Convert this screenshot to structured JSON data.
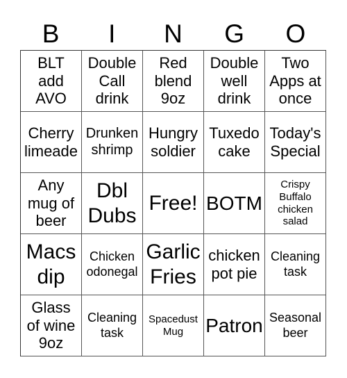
{
  "header": {
    "letters": [
      "B",
      "I",
      "N",
      "G",
      "O"
    ]
  },
  "grid": {
    "rows": [
      [
        "BLT\nadd\nAVO",
        "Double\nCall\ndrink",
        "Red\nblend\n9oz",
        "Double\nwell\ndrink",
        "Two\nApps at\nonce"
      ],
      [
        "Cherry\nlimeade",
        "Drunken\nshrimp",
        "Hungry\nsoldier",
        "Tuxedo\ncake",
        "Today's\nSpecial"
      ],
      [
        "Any\nmug of\nbeer",
        "Dbl\nDubs",
        "Free!",
        "BOTM",
        "Crispy\nBuffalo\nchicken\nsalad"
      ],
      [
        "Macs\ndip",
        "Chicken\nodonegal",
        "Garlic\nFries",
        "chicken\npot pie",
        "Cleaning\ntask"
      ],
      [
        "Glass\nof wine\n9oz",
        "Cleaning\ntask",
        "Spacedust\nMug",
        "Patron",
        "Seasonal\nbeer"
      ]
    ],
    "free_space": "Free!"
  },
  "colors": {
    "grid_line": "#555555",
    "text": "#000000",
    "background": "#ffffff"
  }
}
